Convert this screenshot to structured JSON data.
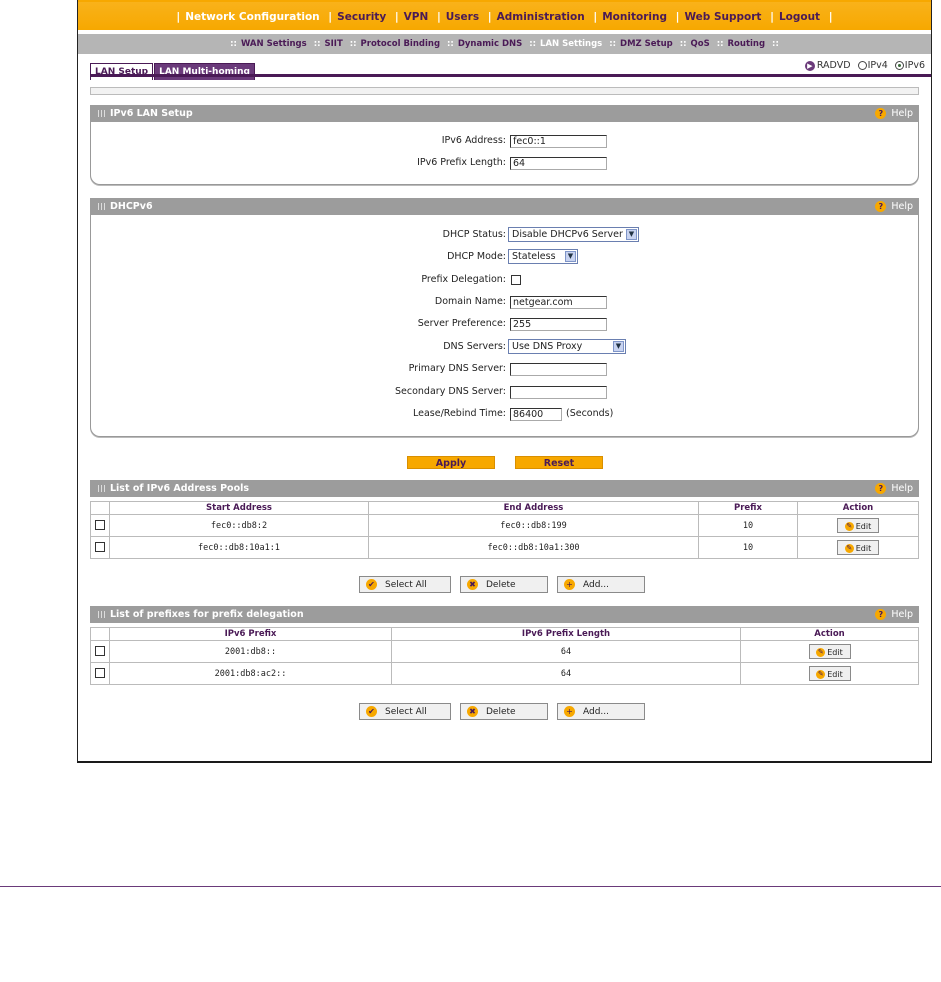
{
  "topnav": {
    "items": [
      "Network Configuration",
      "Security",
      "VPN",
      "Users",
      "Administration",
      "Monitoring",
      "Web Support",
      "Logout"
    ]
  },
  "subnav": {
    "items": [
      "WAN Settings",
      "SIIT",
      "Protocol Binding",
      "Dynamic DNS",
      "LAN Settings",
      "DMZ Setup",
      "QoS",
      "Routing"
    ]
  },
  "tabs": [
    "LAN Setup",
    "LAN Multi-homing"
  ],
  "mode": {
    "radvd": "RADVD",
    "ipv4": "IPv4",
    "ipv6": "IPv6"
  },
  "ipv6_lan": {
    "title": "IPv6 LAN Setup",
    "help": "Help",
    "address_label": "IPv6 Address:",
    "address_value": "fec0::1",
    "prefix_label": "IPv6 Prefix Length:",
    "prefix_value": "64"
  },
  "dhcpv6": {
    "title": "DHCPv6",
    "help": "Help",
    "status_label": "DHCP Status:",
    "status_value": "Disable DHCPv6 Server",
    "mode_label": "DHCP Mode:",
    "mode_value": "Stateless",
    "prefix_delegation_label": "Prefix Delegation:",
    "domain_label": "Domain Name:",
    "domain_value": "netgear.com",
    "server_pref_label": "Server Preference:",
    "server_pref_value": "255",
    "dns_label": "DNS Servers:",
    "dns_value": "Use DNS Proxy",
    "primary_dns_label": "Primary DNS Server:",
    "secondary_dns_label": "Secondary DNS Server:",
    "lease_label": "Lease/Rebind Time:",
    "lease_value": "86400",
    "lease_unit": "(Seconds)"
  },
  "actions": {
    "apply": "Apply",
    "reset": "Reset"
  },
  "pools": {
    "title": "List of IPv6 Address Pools",
    "help": "Help",
    "headers": [
      "Start Address",
      "End Address",
      "Prefix",
      "Action"
    ],
    "rows": [
      {
        "start": "fec0::db8:2",
        "end": "fec0::db8:199",
        "prefix": "10",
        "edit": "Edit"
      },
      {
        "start": "fec0::db8:10a1:1",
        "end": "fec0::db8:10a1:300",
        "prefix": "10",
        "edit": "Edit"
      }
    ],
    "buttons": {
      "select_all": "Select All",
      "delete": "Delete",
      "add": "Add..."
    }
  },
  "prefixes": {
    "title": "List of prefixes for prefix delegation",
    "help": "Help",
    "headers": [
      "IPv6 Prefix",
      "IPv6 Prefix Length",
      "Action"
    ],
    "rows": [
      {
        "prefix": "2001:db8::",
        "length": "64",
        "edit": "Edit"
      },
      {
        "prefix": "2001:db8:ac2::",
        "length": "64",
        "edit": "Edit"
      }
    ],
    "buttons": {
      "select_all": "Select All",
      "delete": "Delete",
      "add": "Add..."
    }
  },
  "colors": {
    "accent": "#f7a800",
    "brand": "#4a1a56",
    "section_header": "#9c9c9c"
  }
}
